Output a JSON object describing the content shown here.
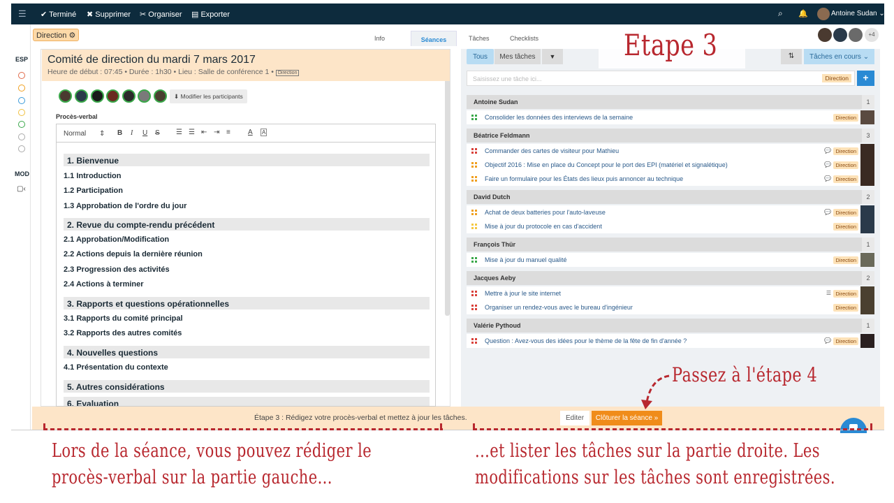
{
  "topbar": {
    "done": "Terminé",
    "delete": "Supprimer",
    "organize": "Organiser",
    "export": "Exporter",
    "user": "Antoine Sudan"
  },
  "header": {
    "space_label": "Direction",
    "tabs": [
      "Info",
      "Séances",
      "Tâches",
      "Checklists"
    ],
    "extra_count": "+4"
  },
  "rail": {
    "esp": "ESP",
    "mod": "MOD"
  },
  "meeting": {
    "title": "Comité de direction du mardi 7 mars 2017",
    "details": "Heure de début : 07:45 • Durée : 1h30 • Lieu : Salle de conférence 1 •",
    "tag": "Direction",
    "edit_participants": "Modifier les participants",
    "minutes_label": "Procès-verbal",
    "style_select": "Normal"
  },
  "minutes": [
    {
      "type": "sec",
      "text": "1. Bienvenue"
    },
    {
      "type": "sub",
      "text": "1.1 Introduction"
    },
    {
      "type": "sub",
      "text": "1.2 Participation"
    },
    {
      "type": "sub",
      "text": "1.3 Approbation de l'ordre du jour"
    },
    {
      "type": "sec",
      "text": "2. Revue du compte-rendu précédent"
    },
    {
      "type": "sub",
      "text": "2.1 Approbation/Modification"
    },
    {
      "type": "sub",
      "text": "2.2 Actions depuis la dernière réunion"
    },
    {
      "type": "sub",
      "text": "2.3 Progression des activités"
    },
    {
      "type": "sub",
      "text": "2.4 Actions à terminer"
    },
    {
      "type": "sec",
      "text": "3. Rapports et questions opérationnelles"
    },
    {
      "type": "sub",
      "text": "3.1 Rapports du comité principal"
    },
    {
      "type": "sub",
      "text": "3.2 Rapports des autres comités"
    },
    {
      "type": "sec",
      "text": "4. Nouvelles questions"
    },
    {
      "type": "sub",
      "text": "4.1 Présentation du contexte"
    },
    {
      "type": "sec",
      "text": "5. Autres considérations"
    },
    {
      "type": "sec",
      "text": "6. Evaluation"
    }
  ],
  "tasks_panel": {
    "filter_all": "Tous",
    "filter_mine": "Mes tâches",
    "status_select": "Tâches en cours",
    "input_placeholder": "Saisissez une tâche ici...",
    "input_tag": "Direction",
    "tag": "Direction",
    "groups": [
      {
        "name": "Antoine Sudan",
        "count": "1",
        "tasks": [
          {
            "text": "Consolider les données des interviews de la semaine",
            "color": "#3aa84a",
            "bub": ""
          }
        ]
      },
      {
        "name": "Béatrice Feldmann",
        "count": "3",
        "tasks": [
          {
            "text": "Commander des cartes de visiteur pour Mathieu",
            "color": "#d9413a",
            "bub": "💬"
          },
          {
            "text": "Objectif 2016 : Mise en place du Concept pour le port des EPI (matériel et signalétique)",
            "color": "#f0a020",
            "bub": "💬"
          },
          {
            "text": "Faire un formulaire pour les États des lieux puis annoncer au technique",
            "color": "#f0a020",
            "bub": "💬"
          }
        ]
      },
      {
        "name": "David Dutch",
        "count": "2",
        "tasks": [
          {
            "text": "Achat de deux batteries pour l'auto-laveuse",
            "color": "#f0a020",
            "bub": "💬"
          },
          {
            "text": "Mise à jour du protocole en cas d'accident",
            "color": "#f5c842",
            "bub": ""
          }
        ]
      },
      {
        "name": "François Thür",
        "count": "1",
        "tasks": [
          {
            "text": "Mise à jour du manuel qualité",
            "color": "#3aa84a",
            "bub": ""
          }
        ]
      },
      {
        "name": "Jacques Aeby",
        "count": "2",
        "tasks": [
          {
            "text": "Mettre à jour le site internet",
            "color": "#d9413a",
            "bub": "☰"
          },
          {
            "text": "Organiser un rendez-vous avec le bureau d'ingénieur",
            "color": "#d9413a",
            "bub": ""
          }
        ]
      },
      {
        "name": "Valérie Pythoud",
        "count": "1",
        "tasks": [
          {
            "text": "Question : Avez-vous des idées pour le thème de la fête de fin d'année ?",
            "color": "#d9413a",
            "bub": "💬"
          }
        ]
      }
    ]
  },
  "footer": {
    "step_text": "Étape 3 : Rédigez votre procès-verbal et mettez à jour les tâches.",
    "edit_btn": "Editer",
    "close_btn": "Clôturer la séance »"
  },
  "annotations": {
    "step3": "Etape 3",
    "step4": "Passez à l'étape 4",
    "left_note_1": "Lors de la séance, vous pouvez rédiger le",
    "left_note_2": "procès-verbal sur la partie gauche...",
    "right_note_1": "...et lister les tâches sur la partie droite. Les",
    "right_note_2": "modifications sur les tâches sont enregistrées."
  },
  "colors": {
    "navy": "#0d2b3d",
    "accent": "#f08c1a",
    "blue": "#2a8ad4",
    "annot": "#b8282f"
  }
}
